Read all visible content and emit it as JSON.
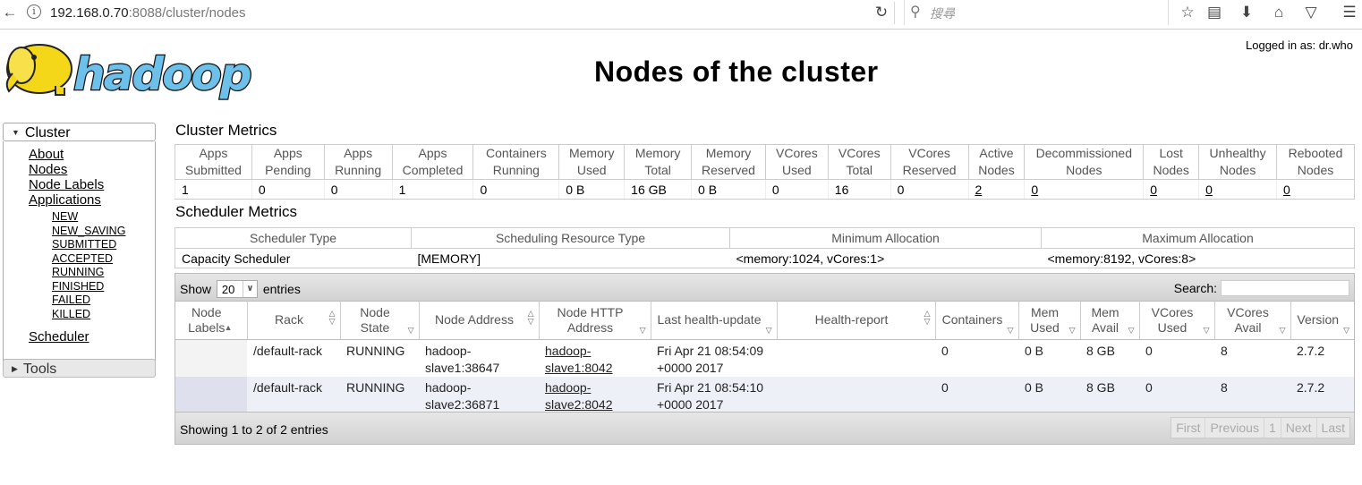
{
  "browser": {
    "url_host": "192.168.0.70",
    "url_rest": ":8088/cluster/nodes",
    "search_placeholder": "搜尋"
  },
  "header": {
    "logged_in": "Logged in as: dr.who",
    "title": "Nodes of the cluster"
  },
  "sidebar": {
    "cluster_label": "Cluster",
    "links": [
      "About",
      "Nodes",
      "Node Labels",
      "Applications"
    ],
    "app_states": [
      "NEW",
      "NEW_SAVING",
      "SUBMITTED",
      "ACCEPTED",
      "RUNNING",
      "FINISHED",
      "FAILED",
      "KILLED"
    ],
    "scheduler_label": "Scheduler",
    "tools_label": "Tools"
  },
  "cluster_metrics": {
    "title": "Cluster Metrics",
    "headers": [
      [
        "Apps",
        "Submitted"
      ],
      [
        "Apps",
        "Pending"
      ],
      [
        "Apps",
        "Running"
      ],
      [
        "Apps",
        "Completed"
      ],
      [
        "Containers",
        "Running"
      ],
      [
        "Memory",
        "Used"
      ],
      [
        "Memory",
        "Total"
      ],
      [
        "Memory",
        "Reserved"
      ],
      [
        "VCores",
        "Used"
      ],
      [
        "VCores",
        "Total"
      ],
      [
        "VCores",
        "Reserved"
      ],
      [
        "Active",
        "Nodes"
      ],
      [
        "Decommissioned",
        "Nodes"
      ],
      [
        "Lost",
        "Nodes"
      ],
      [
        "Unhealthy",
        "Nodes"
      ],
      [
        "Rebooted",
        "Nodes"
      ]
    ],
    "values": [
      "1",
      "0",
      "0",
      "1",
      "0",
      "0 B",
      "16 GB",
      "0 B",
      "0",
      "16",
      "0",
      "2",
      "0",
      "0",
      "0",
      "0"
    ]
  },
  "scheduler_metrics": {
    "title": "Scheduler Metrics",
    "headers": [
      "Scheduler Type",
      "Scheduling Resource Type",
      "Minimum Allocation",
      "Maximum Allocation"
    ],
    "values": [
      "Capacity Scheduler",
      "[MEMORY]",
      "<memory:1024, vCores:1>",
      "<memory:8192, vCores:8>"
    ]
  },
  "nodes_table": {
    "show_label": "Show",
    "page_size": "20",
    "entries_label": "entries",
    "search_label": "Search:",
    "headers": [
      [
        "Node",
        "Labels"
      ],
      [
        "Rack"
      ],
      [
        "Node State"
      ],
      [
        "Node Address"
      ],
      [
        "Node HTTP",
        "Address"
      ],
      [
        "Last health-update"
      ],
      [
        "Health-report"
      ],
      [
        "Containers"
      ],
      [
        "Mem",
        "Used"
      ],
      [
        "Mem",
        "Avail"
      ],
      [
        "VCores",
        "Used"
      ],
      [
        "VCores",
        "Avail"
      ],
      [
        "Version"
      ]
    ],
    "rows": [
      {
        "labels": "",
        "rack": "/default-rack",
        "state": "RUNNING",
        "address": [
          "hadoop-",
          "slave1:38647"
        ],
        "http": [
          "hadoop-",
          "slave1:8042"
        ],
        "health_update": [
          "Fri Apr 21 08:54:09",
          "+0000 2017"
        ],
        "health_report": "",
        "containers": "0",
        "mem_used": "0 B",
        "mem_avail": "8 GB",
        "vc_used": "0",
        "vc_avail": "8",
        "version": "2.7.2"
      },
      {
        "labels": "",
        "rack": "/default-rack",
        "state": "RUNNING",
        "address": [
          "hadoop-",
          "slave2:36871"
        ],
        "http": [
          "hadoop-",
          "slave2:8042"
        ],
        "health_update": [
          "Fri Apr 21 08:54:10",
          "+0000 2017"
        ],
        "health_report": "",
        "containers": "0",
        "mem_used": "0 B",
        "mem_avail": "8 GB",
        "vc_used": "0",
        "vc_avail": "8",
        "version": "2.7.2"
      }
    ],
    "info": "Showing 1 to 2 of 2 entries",
    "pager": [
      "First",
      "Previous",
      "1",
      "Next",
      "Last"
    ]
  }
}
